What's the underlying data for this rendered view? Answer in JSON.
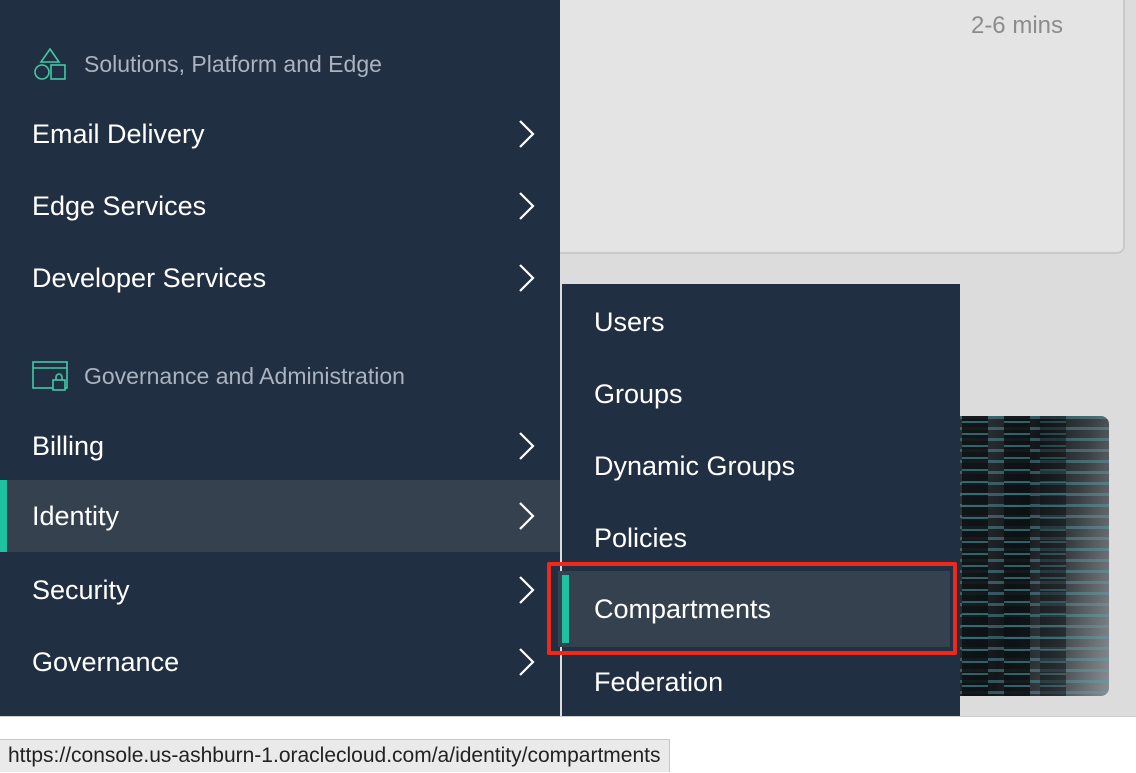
{
  "background": {
    "duration": "2-6 mins"
  },
  "main_menu": {
    "sections": [
      {
        "title": "Solutions, Platform and Edge",
        "icon": "shapes-icon",
        "items": [
          {
            "label": "Email Delivery"
          },
          {
            "label": "Edge Services"
          },
          {
            "label": "Developer Services"
          }
        ]
      },
      {
        "title": "Governance and Administration",
        "icon": "admin-window-lock-icon",
        "items": [
          {
            "label": "Billing"
          },
          {
            "label": "Identity",
            "active": true
          },
          {
            "label": "Security"
          },
          {
            "label": "Governance"
          }
        ]
      }
    ]
  },
  "sub_menu": {
    "parent": "Identity",
    "items": [
      {
        "label": "Users"
      },
      {
        "label": "Groups"
      },
      {
        "label": "Dynamic Groups"
      },
      {
        "label": "Policies"
      },
      {
        "label": "Compartments",
        "active": true,
        "highlighted": true
      },
      {
        "label": "Federation"
      }
    ]
  },
  "status_bar": {
    "url": "https://console.us-ashburn-1.oraclecloud.com/a/identity/compartments"
  },
  "colors": {
    "menu_bg": "#212f42",
    "active_bg": "#35414f",
    "accent": "#1ec2a0",
    "highlight": "#f0281a"
  }
}
